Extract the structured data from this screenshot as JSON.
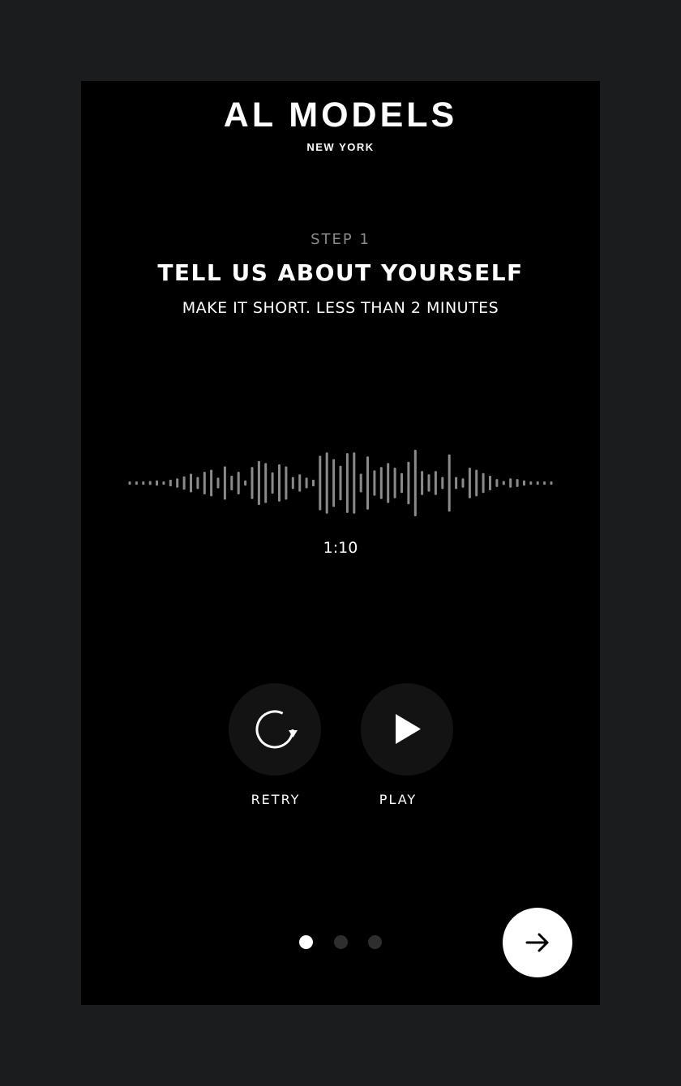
{
  "brand": {
    "name": "AL MODELS",
    "city": "NEW YORK"
  },
  "step": {
    "label": "STEP 1",
    "title": "TELL US ABOUT YOURSELF",
    "subtitle": "MAKE IT SHORT. LESS THAN 2 MINUTES"
  },
  "recording": {
    "duration": "1:10",
    "waveform_amplitudes": [
      0.05,
      0.05,
      0.05,
      0.06,
      0.08,
      0.05,
      0.1,
      0.14,
      0.2,
      0.28,
      0.18,
      0.34,
      0.4,
      0.16,
      0.5,
      0.22,
      0.34,
      0.08,
      0.48,
      0.66,
      0.6,
      0.32,
      0.56,
      0.5,
      0.18,
      0.26,
      0.16,
      0.1,
      0.82,
      0.92,
      0.72,
      0.52,
      0.9,
      0.92,
      0.28,
      0.8,
      0.38,
      0.48,
      0.6,
      0.46,
      0.3,
      0.64,
      1.0,
      0.36,
      0.26,
      0.36,
      0.18,
      0.86,
      0.18,
      0.14,
      0.46,
      0.4,
      0.3,
      0.22,
      0.12,
      0.06,
      0.14,
      0.12,
      0.08,
      0.05,
      0.05,
      0.05,
      0.05
    ],
    "waveform_color": "#8a8a8a"
  },
  "controls": {
    "retry": {
      "label": "RETRY",
      "icon": "retry-icon"
    },
    "play": {
      "label": "PLAY",
      "icon": "play-icon"
    }
  },
  "pagination": {
    "total": 3,
    "current": 1
  },
  "next": {
    "icon": "arrow-right-icon"
  }
}
